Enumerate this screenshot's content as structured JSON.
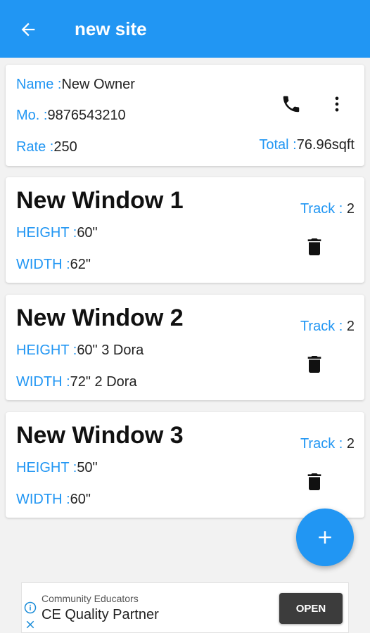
{
  "appbar": {
    "title": "new site",
    "back_icon": "arrow-back-icon"
  },
  "owner": {
    "name_label": "Name :",
    "name_value": "New Owner",
    "mobile_label": "Mo. :",
    "mobile_value": "9876543210",
    "rate_label": "Rate :",
    "rate_value": "250",
    "total_label": "Total :",
    "total_value": "76.96sqft",
    "call_icon": "phone-icon",
    "menu_icon": "more-vert-icon"
  },
  "windows": [
    {
      "title": "New Window 1",
      "height_label": "HEIGHT :",
      "height_value": "60\"",
      "width_label": "WIDTH :",
      "width_value": "62\"",
      "track_label": "Track : ",
      "track_value": "2"
    },
    {
      "title": "New Window 2",
      "height_label": "HEIGHT :",
      "height_value": "60\" 3 Dora",
      "width_label": "WIDTH :",
      "width_value": "72\" 2 Dora",
      "track_label": "Track : ",
      "track_value": "2"
    },
    {
      "title": "New Window 3",
      "height_label": "HEIGHT :",
      "height_value": "50\"",
      "width_label": "WIDTH :",
      "width_value": "60\"",
      "track_label": "Track : ",
      "track_value": "2"
    }
  ],
  "fab": {
    "icon": "add-icon",
    "label": "+"
  },
  "ad": {
    "advertiser": "Community Educators",
    "headline": "CE Quality Partner",
    "button_label": "OPEN",
    "info_icon": "info-icon",
    "close_icon": "close-icon"
  },
  "colors": {
    "primary": "#2196f3",
    "label_blue": "#2196f3",
    "text": "#222222",
    "background": "#f2f2f2"
  }
}
